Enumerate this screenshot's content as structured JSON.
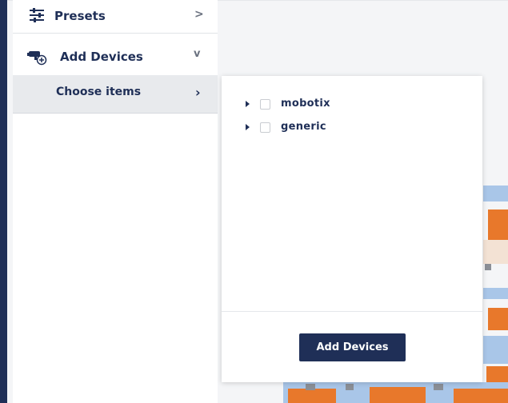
{
  "sidebar": {
    "presets_label": "Presets",
    "presets_chevron": ">",
    "add_devices_label": "Add Devices",
    "add_devices_chevron": "v",
    "choose_items_label": "Choose items",
    "choose_items_chevron": "›"
  },
  "popup": {
    "tree": [
      {
        "label": "mobotix",
        "checked": false,
        "expanded": false
      },
      {
        "label": "generic",
        "checked": false,
        "expanded": false
      }
    ],
    "add_button_label": "Add Devices"
  },
  "icons": {
    "presets": "sliders-icon",
    "add_devices": "camera-add-icon",
    "tree_expand": "caret-right-icon"
  },
  "colors": {
    "brand": "#1f2f57",
    "sidebar_active_bg": "#e8eaed",
    "floorplan_orange": "#e8782b",
    "floorplan_blue": "#a9c6e8",
    "floorplan_gray": "#8b8f96"
  }
}
